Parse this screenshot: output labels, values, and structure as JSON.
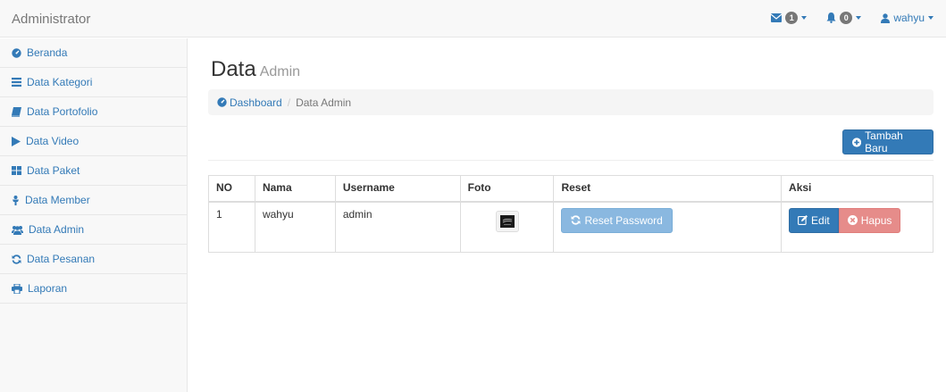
{
  "app": {
    "title": "Administrator"
  },
  "topnav": {
    "messages_count": "1",
    "alerts_count": "0",
    "user_name": "wahyu"
  },
  "sidebar": {
    "items": [
      {
        "label": "Beranda",
        "icon": "dashboard-icon"
      },
      {
        "label": "Data Kategori",
        "icon": "list-icon"
      },
      {
        "label": "Data Portofolio",
        "icon": "book-icon"
      },
      {
        "label": "Data Video",
        "icon": "play-icon"
      },
      {
        "label": "Data Paket",
        "icon": "grid-icon"
      },
      {
        "label": "Data Member",
        "icon": "user-icon"
      },
      {
        "label": "Data Admin",
        "icon": "users-icon"
      },
      {
        "label": "Data Pesanan",
        "icon": "refresh-icon"
      },
      {
        "label": "Laporan",
        "icon": "print-icon"
      }
    ]
  },
  "page": {
    "title": "Data",
    "subtitle": "Admin",
    "breadcrumb": {
      "home": "Dashboard",
      "current": "Data Admin"
    },
    "add_button": "Tambah Baru"
  },
  "table": {
    "headers": [
      "NO",
      "Nama",
      "Username",
      "Foto",
      "Reset",
      "Aksi"
    ],
    "rows": [
      {
        "no": "1",
        "nama": "wahyu",
        "username": "admin",
        "reset_label": "Reset Password",
        "edit_label": "Edit",
        "delete_label": "Hapus"
      }
    ]
  },
  "colors": {
    "link": "#337ab7",
    "primary": "#337ab7",
    "reset": "#8ab8e0",
    "danger": "#e68c8a"
  }
}
